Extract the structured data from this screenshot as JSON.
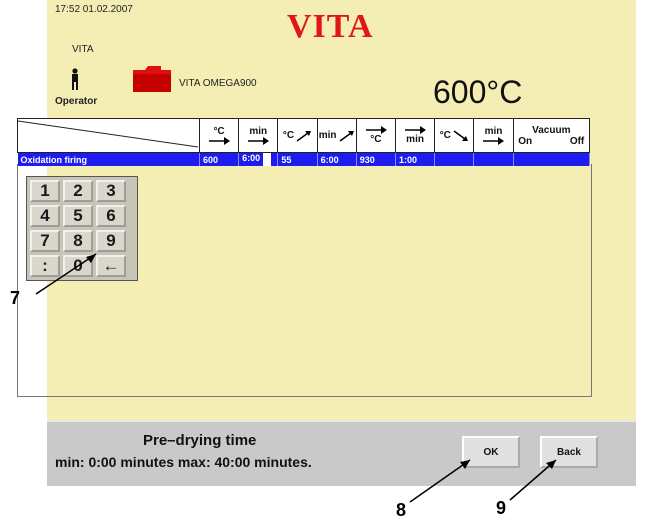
{
  "header": {
    "clock": "17:52  01.02.2007",
    "brand": "VITA",
    "user_name": "VITA",
    "operator_label": "Operator",
    "program_name": "VITA OMEGA900",
    "current_temperature": "600°C"
  },
  "table": {
    "columns": [
      {
        "label": "°C",
        "icon": "arrow-right-icon"
      },
      {
        "label": "min",
        "icon": "arrow-right-icon"
      },
      {
        "label": "°C",
        "icon": "ramp-up-arrow-icon"
      },
      {
        "label": "min",
        "icon": "ramp-up-arrow-icon"
      },
      {
        "label": "°C",
        "icon": "arrow-right-icon"
      },
      {
        "label": "min",
        "icon": "arrow-right-icon"
      },
      {
        "label": "°C",
        "icon": "ramp-down-arrow-icon"
      },
      {
        "label": "min",
        "icon": "arrow-right-icon"
      }
    ],
    "vacuum_label": "Vacuum",
    "vacuum_on": "On",
    "vacuum_off": "Off",
    "row": {
      "name": "Oxidation firing",
      "values": [
        "600",
        "6:00",
        "",
        "55",
        "6:00",
        "930",
        "1:00",
        "",
        "",
        "",
        ""
      ]
    }
  },
  "keypad": {
    "keys": [
      "1",
      "2",
      "3",
      "4",
      "5",
      "6",
      "7",
      "8",
      "9",
      ":",
      "0",
      "←"
    ]
  },
  "footer": {
    "hint_title": "Pre–drying time",
    "hint_range": "min: 0:00 minutes max: 40:00 minutes.",
    "ok_label": "OK",
    "back_label": "Back"
  },
  "callouts": {
    "keypad": "7",
    "ok": "8",
    "back": "9"
  },
  "colors": {
    "screen_bg": "#f5eeb4",
    "brand": "#e11717",
    "selected_row": "#1d1df0",
    "folder": "#e01010"
  }
}
